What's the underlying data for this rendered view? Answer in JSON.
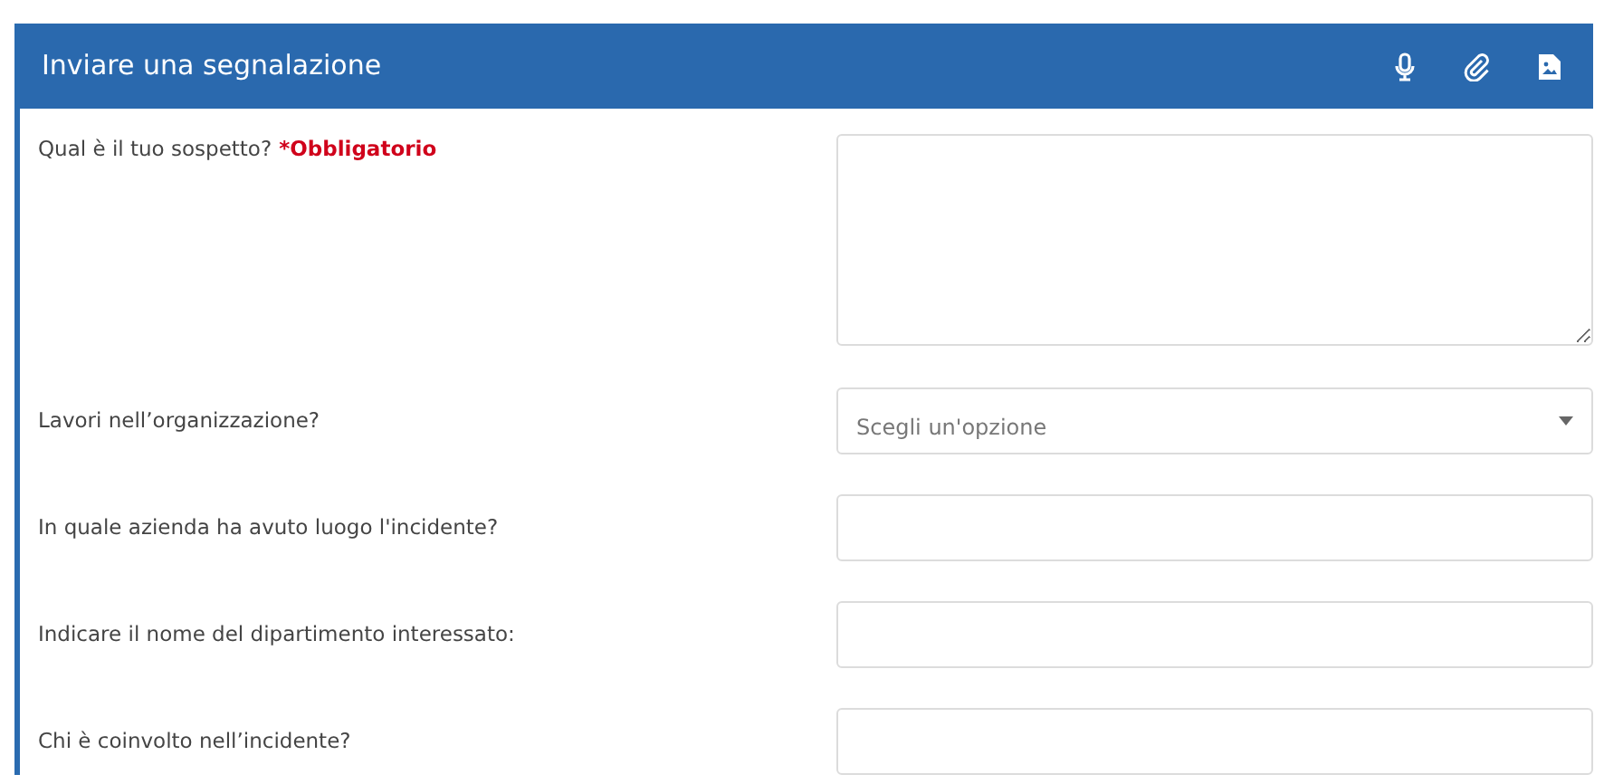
{
  "header": {
    "title": "Inviare una segnalazione"
  },
  "fields": [
    {
      "kind": "textarea",
      "label": "Qual è il tuo sospetto?",
      "required_note": "*Obbligatorio"
    },
    {
      "kind": "select",
      "label": "Lavori nell’organizzazione?",
      "placeholder": "Scegli un'opzione"
    },
    {
      "kind": "text",
      "label": "In quale azienda ha avuto luogo l'incidente?"
    },
    {
      "kind": "text",
      "label": "Indicare il nome del dipartimento interessato:"
    },
    {
      "kind": "text",
      "label": "Chi è coinvolto nell’incidente?"
    }
  ]
}
